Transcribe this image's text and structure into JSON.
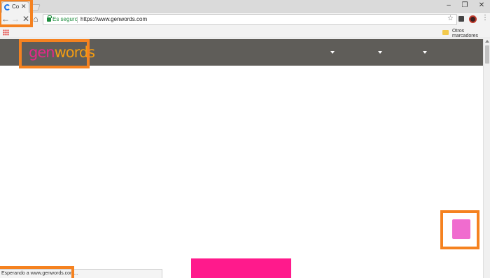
{
  "browser": {
    "tab": {
      "title": "Co",
      "close": "✕"
    },
    "window_controls": {
      "minimize": "–",
      "restore": "❐",
      "close": "✕"
    },
    "nav": {
      "back": "←",
      "forward": "→",
      "reload": "✕",
      "home": "⌂"
    },
    "omnibox": {
      "secure_label": "Es seguro",
      "url": "https://www.genwords.com"
    },
    "toolbar": {
      "star": "☆",
      "menu": "⋮"
    },
    "bookmarks": {
      "others_label": "Otros marcadores"
    },
    "status_text": "Esperando a www.genwords.com..."
  },
  "site": {
    "logo_part1": "gen",
    "logo_part2": "words"
  },
  "colors": {
    "header_bg": "#5f5d59",
    "logo_pink": "#e8268a",
    "logo_orange": "#f39c12",
    "highlight": "#f58220",
    "pink_square": "#f06ccf",
    "pink_bar": "#ff1a8c"
  },
  "icons": [
    "back-icon",
    "forward-icon",
    "stop-icon",
    "home-icon",
    "lock-icon",
    "star-icon",
    "apps-icon",
    "folder-icon",
    "menu-icon",
    "favicon-icon"
  ]
}
